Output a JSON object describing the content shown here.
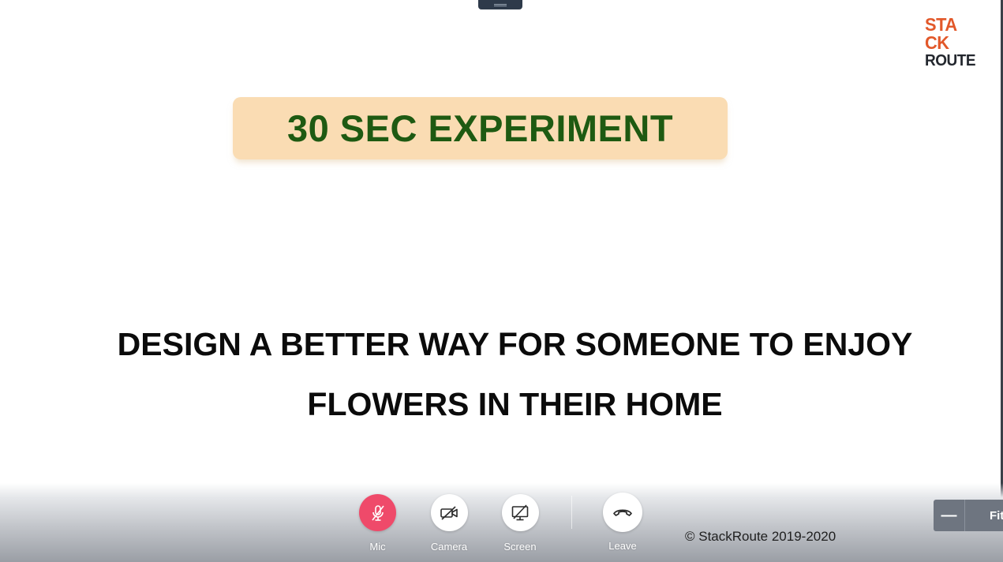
{
  "slide": {
    "logo": {
      "line1": "STA",
      "line2": "CK",
      "line3": "ROUTE"
    },
    "banner": "30 SEC EXPERIMENT",
    "question_line1": "DESIGN A BETTER WAY FOR SOMEONE TO ENJOY",
    "question_line2": "FLOWERS IN THEIR HOME"
  },
  "toolbar": {
    "mic_label": "Mic",
    "camera_label": "Camera",
    "screen_label": "Screen",
    "leave_label": "Leave",
    "copyright": "© StackRoute 2019-2020",
    "zoom_minus": "—",
    "zoom_fit": "Fit"
  },
  "colors": {
    "mic_muted": "#ef4a6a",
    "logo_orange": "#e2582a",
    "banner_bg": "#fadcb3",
    "banner_text": "#1e5a12"
  },
  "icons": {
    "mic": "mic-off-icon",
    "camera": "camera-off-icon",
    "screen": "screen-share-off-icon",
    "leave": "phone-hangup-icon",
    "handle": "drag-handle-icon"
  }
}
